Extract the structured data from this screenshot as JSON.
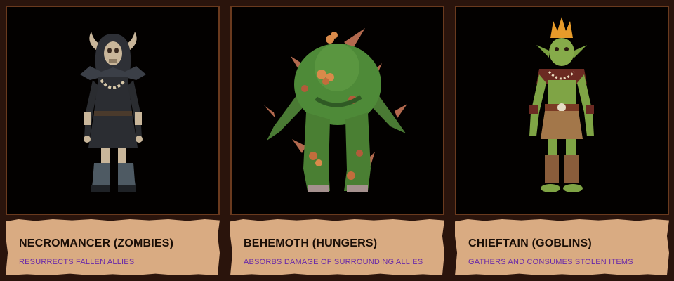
{
  "cards": [
    {
      "name": "NECROMANCER (ZOMBIES)",
      "ability": "RESURRECTS FALLEN ALLIES",
      "portrait_icon": "skeleton-necromancer-icon"
    },
    {
      "name": "BEHEMOTH (HUNGERS)",
      "ability": "ABSORBS DAMAGE OF SURROUNDING ALLIES",
      "portrait_icon": "green-behemoth-icon"
    },
    {
      "name": "CHIEFTAIN (GOBLINS)",
      "ability": "GATHERS AND CONSUMES STOLEN ITEMS",
      "portrait_icon": "goblin-chieftain-icon"
    }
  ],
  "colors": {
    "background": "#2a140c",
    "frame": "#6a3a1e",
    "plate": "#d9ab82",
    "ability_text": "#6a2aa8"
  }
}
